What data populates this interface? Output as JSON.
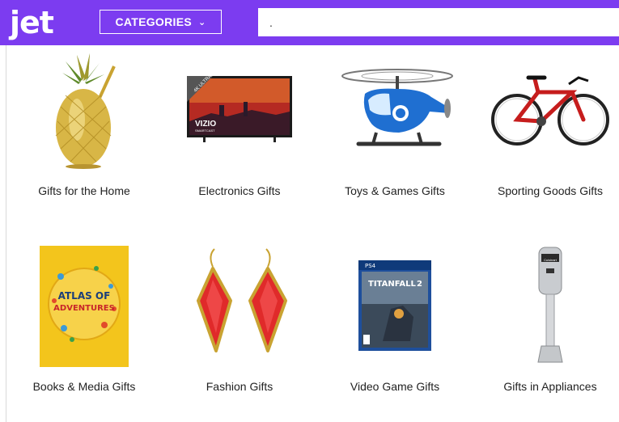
{
  "header": {
    "logo_text": "jet",
    "categories_label": "CATEGORIES",
    "search_value": "."
  },
  "tiles": [
    {
      "label": "Gifts for the Home",
      "icon": "gold-pineapple-tumbler-icon"
    },
    {
      "label": "Electronics Gifts",
      "icon": "vizio-tv-icon",
      "tv_brand": "VIZIO",
      "tv_sub": "SMARTCAST",
      "tv_badge": "4K ULTRA HD"
    },
    {
      "label": "Toys & Games Gifts",
      "icon": "toy-helicopter-icon"
    },
    {
      "label": "Sporting Goods Gifts",
      "icon": "red-bicycle-icon"
    },
    {
      "label": "Books & Media Gifts",
      "icon": "atlas-of-adventures-book-icon",
      "book_title_1": "ATLAS OF",
      "book_title_2": "ADVENTURES"
    },
    {
      "label": "Fashion Gifts",
      "icon": "red-earrings-icon"
    },
    {
      "label": "Video Game Gifts",
      "icon": "titanfall-2-game-icon",
      "game_platform": "PS4",
      "game_title": "TITANFALL",
      "game_num": "2"
    },
    {
      "label": "Gifts in Appliances",
      "icon": "immersion-blender-icon",
      "blender_brand": "Cuisinart"
    }
  ],
  "colors": {
    "brand_purple": "#7c3cf0",
    "gold": "#d8b646",
    "tv_red": "#c0201a",
    "bike_red": "#c61d1d",
    "earring_red": "#e02a2a",
    "book_yellow": "#f3c51c"
  }
}
